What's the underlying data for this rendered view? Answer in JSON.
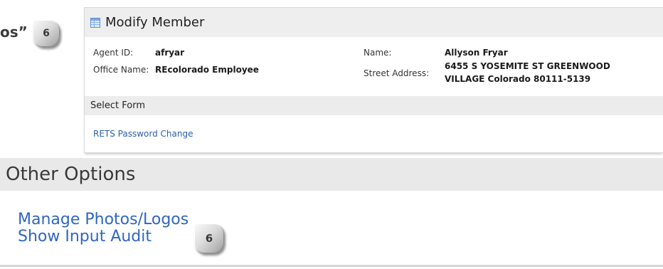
{
  "instruction_fragment": "os”",
  "step_badges": [
    {
      "number": "6"
    },
    {
      "number": "6"
    }
  ],
  "modify_member_panel": {
    "title": "Modify Member",
    "title_icon": "table-icon",
    "agent_id": {
      "label": "Agent ID:",
      "value": "afryar"
    },
    "office_name": {
      "label": "Office Name:",
      "value": "REcolorado Employee"
    },
    "name": {
      "label": "Name:",
      "value": "Allyson Fryar"
    },
    "street_address": {
      "label": "Street Address:",
      "value": "6455 S YOSEMITE ST GREENWOOD VILLAGE Colorado 80111-5139"
    },
    "select_form": {
      "heading": "Select Form",
      "links": [
        {
          "label": "RETS Password Change"
        }
      ]
    }
  },
  "other_options": {
    "heading": "Other Options",
    "links": [
      {
        "label": "Manage Photos/Logos"
      },
      {
        "label": "Show Input Audit"
      }
    ]
  },
  "colors": {
    "link": "#2f66c0",
    "panel_header_bg": "#eeeeee",
    "section_bar_bg": "#e9e9e9",
    "badge": "#c9c9c9"
  }
}
